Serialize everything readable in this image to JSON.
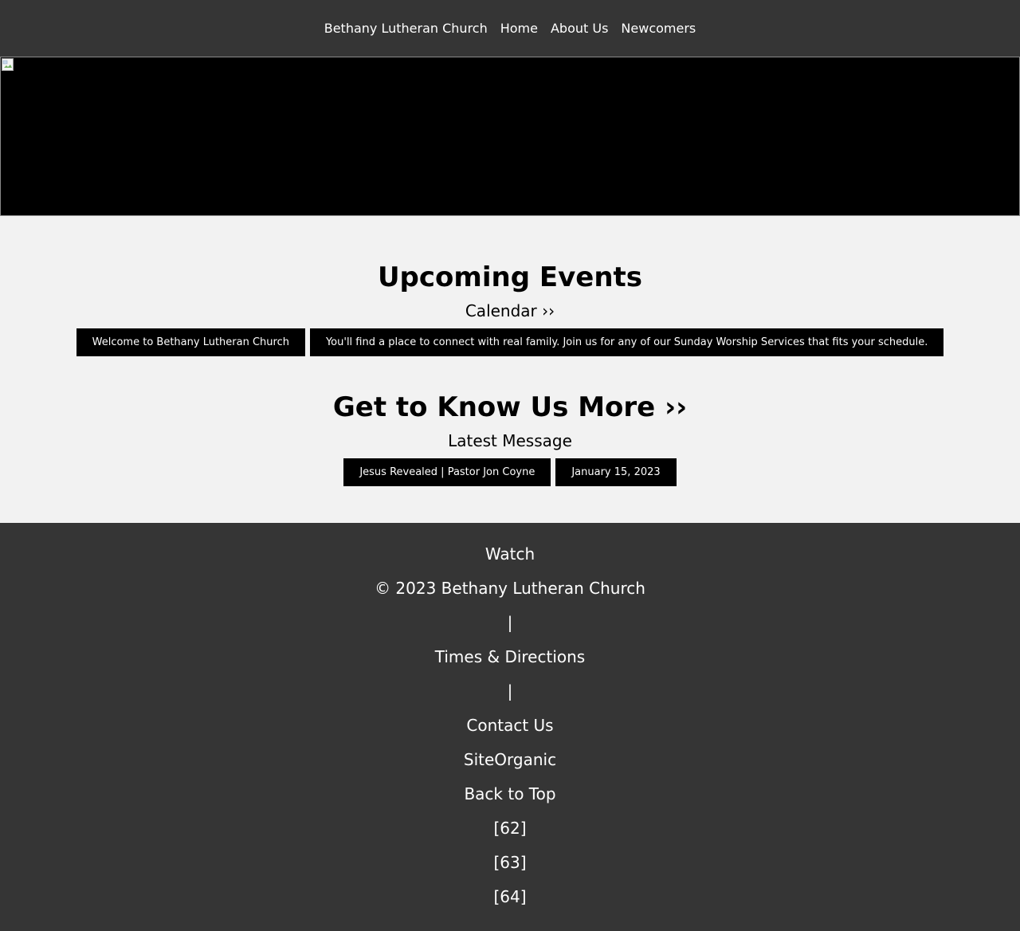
{
  "nav": {
    "items": [
      "Bethany Lutheran Church",
      "Home",
      "About Us",
      "Newcomers"
    ]
  },
  "events": {
    "title": "Upcoming Events",
    "calendar_link": "Calendar ››",
    "items": [
      "Welcome to Bethany Lutheran Church",
      "You'll find a place to connect with real family. Join us for any of our Sunday Worship Services that fits your schedule."
    ]
  },
  "about": {
    "title": "Get to Know Us More ››",
    "latest_label": "Latest Message",
    "message_title": "Jesus Revealed | Pastor Jon Coyne",
    "message_date": "January 15, 2023"
  },
  "footer": {
    "items": [
      "Watch",
      "© 2023 Bethany Lutheran Church",
      "|",
      "Times & Directions",
      "|",
      "Contact Us",
      "SiteOrganic",
      "Back to Top",
      "[62]",
      "[63]",
      "[64]"
    ]
  },
  "colors": {
    "nav_bg": "#353535",
    "page_bg": "#f2f2f2",
    "button_bg": "#000000",
    "text_light": "#ffffff"
  }
}
